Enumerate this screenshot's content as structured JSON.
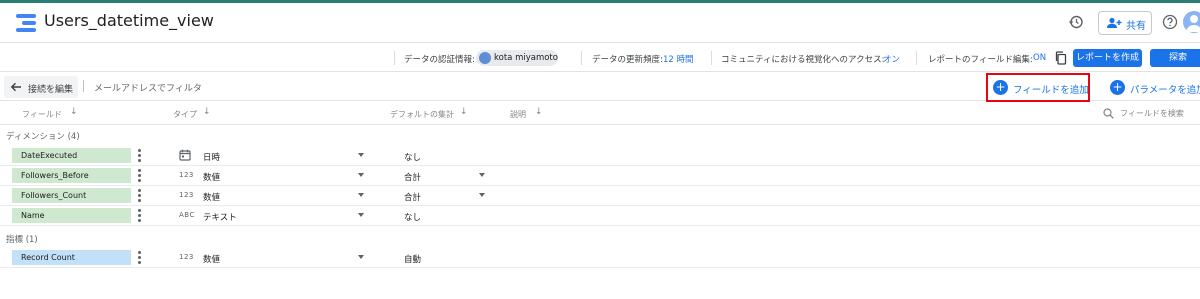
{
  "app": {
    "title": "Users_datetime_view",
    "share_label": "共有",
    "accent": "#1a73e8",
    "top_border_color": "#2a7d72"
  },
  "infobar": {
    "credentials_label": "データの認証情報:",
    "owner_name": "kota miyamoto",
    "refresh_label": "データの更新頻度:",
    "refresh_value": "12 時間",
    "community_label": "コミュニティにおける視覚化へのアクセス:",
    "community_value": "オン",
    "field_edit_label": "レポートのフィールド編集:",
    "field_edit_value": "ON",
    "create_report_label": "レポートを作成",
    "explore_label": "探索"
  },
  "editbar": {
    "back_label": "接続を編集",
    "email_filter_label": "メールアドレスでフィルタ",
    "add_field_label": "フィールドを追加",
    "add_parameter_label": "パラメータを追加",
    "highlight_color": "#e30613"
  },
  "columns": {
    "field": "フィールド",
    "type": "タイプ",
    "default_agg": "デフォルトの集計",
    "description": "説明",
    "search_placeholder": "フィールドを検索"
  },
  "dimensions": {
    "label": "ディメンション (4)",
    "color": "#cfe8d0",
    "rows": [
      {
        "name": "DateExecuted",
        "type_icon": "calendar-icon",
        "type": "日時",
        "aggregation": "なし"
      },
      {
        "name": "Followers_Before",
        "type_icon": "123",
        "type": "数値",
        "aggregation": "合計"
      },
      {
        "name": "Followers_Count",
        "type_icon": "123",
        "type": "数値",
        "aggregation": "合計"
      },
      {
        "name": "Name",
        "type_icon": "ABC",
        "type": "テキスト",
        "aggregation": "なし"
      }
    ]
  },
  "metrics": {
    "label": "指標 (1)",
    "color": "#c2e0f7",
    "rows": [
      {
        "name": "Record Count",
        "type_icon": "123",
        "type": "数値",
        "aggregation": "自動"
      }
    ]
  }
}
